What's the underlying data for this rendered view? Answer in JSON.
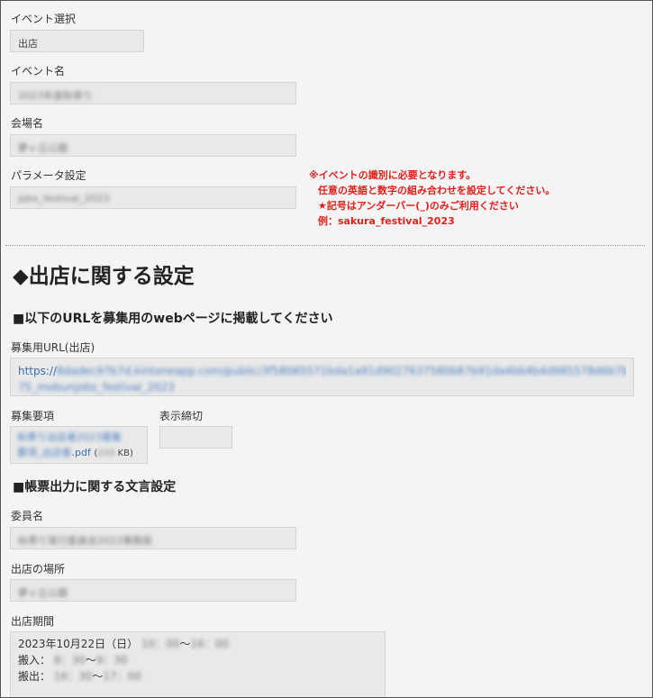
{
  "event_select": {
    "label": "イベント選択",
    "value": "出店"
  },
  "event_name": {
    "label": "イベント名",
    "value": "2023年度秋祭り"
  },
  "venue": {
    "label": "会場名",
    "value": "夢ヶ丘公園"
  },
  "param": {
    "label": "パラメータ設定",
    "value": "jobs_festival_2023"
  },
  "notes": {
    "line1": "※イベントの識別に必要となります。",
    "line2": "任意の英語と数字の組み合わせを設定してください。",
    "line3": "★記号はアンダーバー(_)のみご利用ください",
    "line4": "例：sakura_festival_2023"
  },
  "section": {
    "title": "◆出店に関する設定"
  },
  "url_section": {
    "heading": "■以下のURLを募集用のwebページに掲載してください",
    "label": "募集用URL(出店)",
    "url_prefix": "https://",
    "url_blur_1": "8dadec97b7d.kintoneapp.com/public/3f58085571bda1a91d9027637580b87b91da4bb4b4d985578d6b7bb7b8b0a",
    "url_blur_2": "75_mobunjobs_festival_2023"
  },
  "recruit": {
    "label": "募集要項",
    "file_blur_1": "秋祭り出店者2023募集",
    "file_blur_2": "要項_出店者",
    "file_ext": ".pdf",
    "size_open": "(",
    "size_blur": "233",
    "size_unit": "KB)"
  },
  "display_deadline": {
    "label": "表示締切",
    "value": ""
  },
  "doc_section": {
    "heading": "■帳票出力に関する文言設定"
  },
  "committee": {
    "label": "委員名",
    "value": "秋祭り実行委員会2023事務局"
  },
  "shop_place": {
    "label": "出店の場所",
    "value": "夢ヶ丘公園"
  },
  "period": {
    "label": "出店期間",
    "date": "2023年10月22日（日）",
    "time_blur_1": "10：00",
    "tilde": "〜",
    "time_blur_2": "16：00",
    "in_label": "搬入：",
    "in_blur_1": "8：30",
    "in_blur_2": "9：30",
    "out_label": "搬出：",
    "out_blur_1": "16：30",
    "out_blur_2": "17：00"
  }
}
